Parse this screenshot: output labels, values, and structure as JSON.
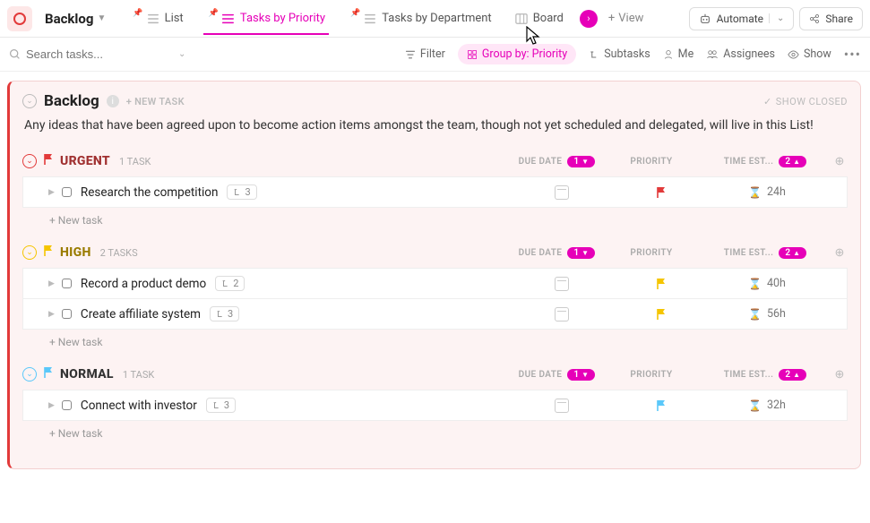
{
  "header": {
    "title": "Backlog",
    "views": [
      {
        "label": "List"
      },
      {
        "label": "Tasks by Priority"
      },
      {
        "label": "Tasks by Department"
      },
      {
        "label": "Board"
      }
    ],
    "add_view": "View",
    "automate": "Automate",
    "share": "Share"
  },
  "filterbar": {
    "search_placeholder": "Search tasks...",
    "filter": "Filter",
    "group_by": "Group by: Priority",
    "subtasks": "Subtasks",
    "me": "Me",
    "assignees": "Assignees",
    "show": "Show"
  },
  "panel": {
    "title": "Backlog",
    "new_task": "+ NEW TASK",
    "show_closed": "SHOW CLOSED",
    "description": "Any ideas that have been agreed upon to become action items amongst the team, though not yet scheduled and delegated, will live in this List!"
  },
  "columns": {
    "due": "DUE DATE",
    "priority": "PRIORITY",
    "time": "TIME EST...",
    "due_badge": "1",
    "time_badge": "2"
  },
  "groups": [
    {
      "key": "urgent",
      "name": "URGENT",
      "count": "1 TASK",
      "color": "#e23a3a",
      "flag": "#e23a3a",
      "tasks": [
        {
          "name": "Research the competition",
          "sub": "3",
          "time": "24h",
          "flag": "#e23a3a"
        }
      ]
    },
    {
      "key": "high",
      "name": "HIGH",
      "count": "2 TASKS",
      "color": "#f5c500",
      "flag": "#f5c500",
      "tasks": [
        {
          "name": "Record a product demo",
          "sub": "2",
          "time": "40h",
          "flag": "#f5c500"
        },
        {
          "name": "Create affiliate system",
          "sub": "3",
          "time": "56h",
          "flag": "#f5c500"
        }
      ]
    },
    {
      "key": "normal",
      "name": "NORMAL",
      "count": "1 TASK",
      "color": "#5ac8fa",
      "flag": "#5ac8fa",
      "tasks": [
        {
          "name": "Connect with investor",
          "sub": "3",
          "time": "32h",
          "flag": "#5ac8fa"
        }
      ]
    }
  ],
  "new_task_row": "+ New task"
}
